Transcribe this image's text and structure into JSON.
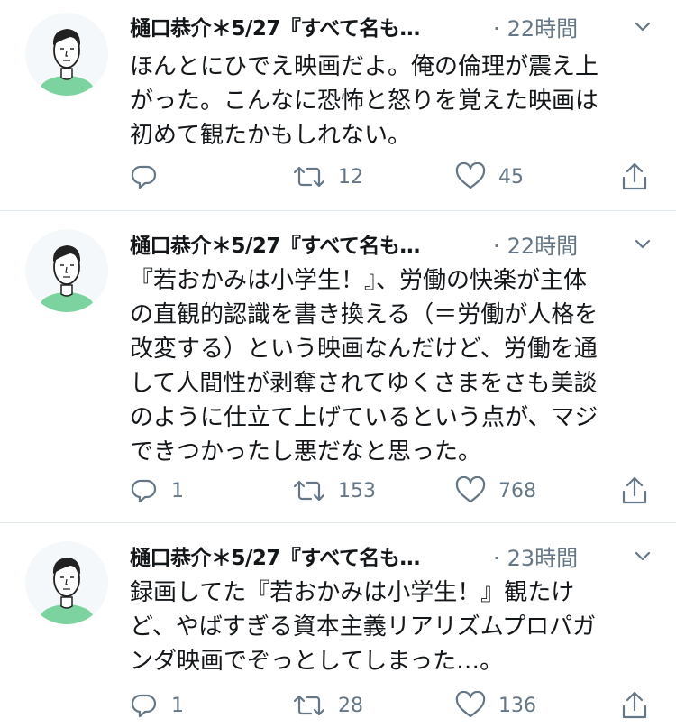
{
  "icons": {
    "reply": "reply-icon",
    "retweet": "retweet-icon",
    "like": "heart-icon",
    "share": "share-icon",
    "caret": "chevron-down-icon"
  },
  "colors": {
    "text": "#14171a",
    "muted": "#657786",
    "divider": "#e1e8ed",
    "avatar_shirt": "#7dd3a0"
  },
  "tweets": [
    {
      "author": "樋口恭介＊5/27『すべて名も…",
      "time": "22時間",
      "lines": [
        "ほんとにひでえ映画だよ。俺の倫理が震え上",
        "がった。こんなに恐怖と怒りを覚えた映画は",
        "初めて観たかもしれない。"
      ],
      "replies": "",
      "retweets": "12",
      "likes": "45"
    },
    {
      "author": "樋口恭介＊5/27『すべて名も…",
      "time": "22時間",
      "lines": [
        "『若おかみは小学生！』、労働の快楽が主体",
        "の直観的認識を書き換える（＝労働が人格を",
        "改変する）という映画なんだけど、労働を通",
        "して人間性が剥奪されてゆくさまをさも美談",
        "のように仕立て上げているという点が、マジ",
        "できつかったし悪だなと思った。"
      ],
      "replies": "1",
      "retweets": "153",
      "likes": "768"
    },
    {
      "author": "樋口恭介＊5/27『すべて名も…",
      "time": "23時間",
      "lines": [
        "録画してた『若おかみは小学生！』観たけ",
        "ど、やばすぎる資本主義リアリズムプロパガ",
        "ンダ映画でぞっとしてしまった…。"
      ],
      "replies": "1",
      "retweets": "28",
      "likes": "136"
    }
  ]
}
